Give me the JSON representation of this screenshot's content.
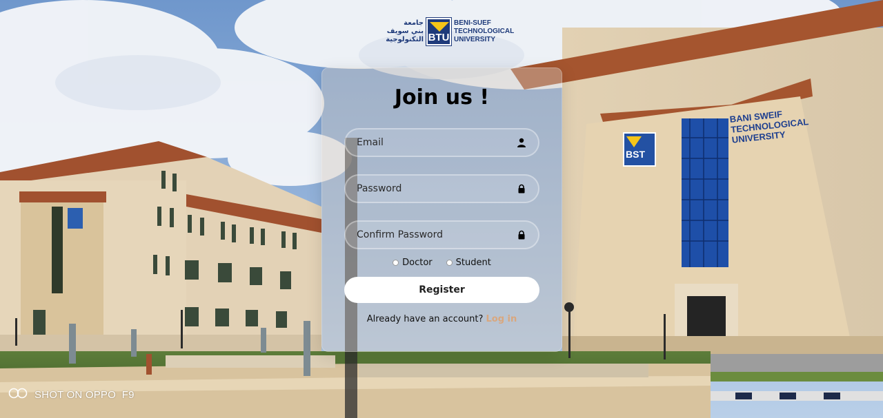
{
  "logo": {
    "arabic_lines": [
      "جامعة",
      "بني سويف",
      "التكنولوجية"
    ],
    "mark": "BTU",
    "english_lines": [
      "BENI-SUEF",
      "TECHNOLOGICAL",
      "UNIVERSITY"
    ]
  },
  "form": {
    "title": "Join us !",
    "email": {
      "placeholder": "Email",
      "value": "",
      "icon": "user-icon"
    },
    "password": {
      "placeholder": "Password",
      "value": "",
      "icon": "lock-icon"
    },
    "confirm_password": {
      "placeholder": "Confirm Password",
      "value": "",
      "icon": "lock-icon"
    },
    "roles": [
      {
        "label": "Doctor",
        "selected": false
      },
      {
        "label": "Student",
        "selected": false
      }
    ],
    "register_label": "Register",
    "login_prompt": "Already have an account?",
    "login_link": "Log in"
  },
  "background": {
    "building_sign_lines": [
      "BANI SWEIF",
      "TECHNOLOGICAL",
      "UNIVERSITY"
    ],
    "building_badge": "BST"
  },
  "watermark": {
    "text": "SHOT ON OPPO  F9"
  },
  "colors": {
    "link_accent": "#d9a77e",
    "logo_blue": "#1e3a7a",
    "logo_yellow": "#f5c518"
  }
}
